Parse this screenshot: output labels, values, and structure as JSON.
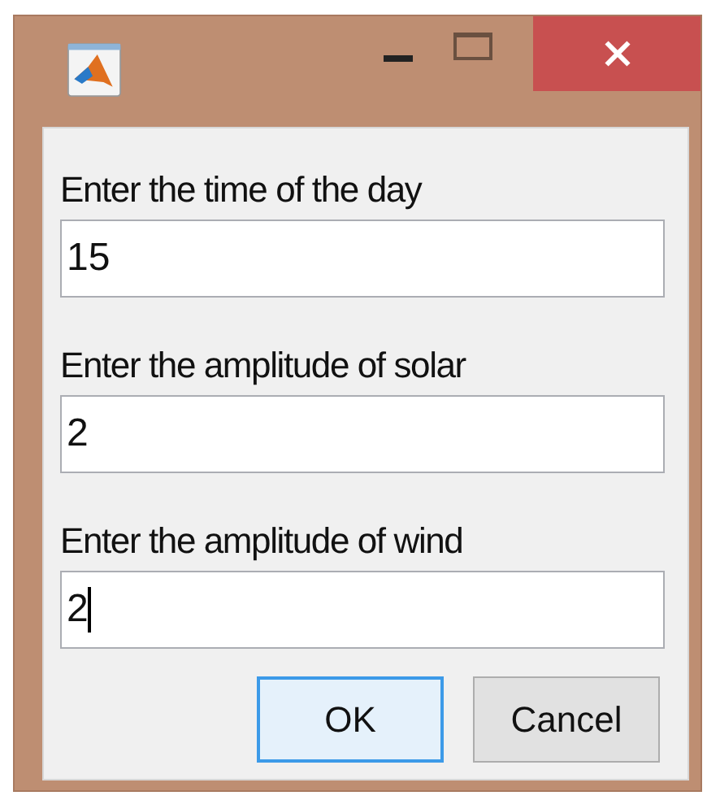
{
  "fields": [
    {
      "label": "Enter the time of the day",
      "value": "15",
      "focused": false
    },
    {
      "label": "Enter the amplitude of solar",
      "value": "2",
      "focused": false
    },
    {
      "label": "Enter the amplitude of wind",
      "value": "2",
      "focused": true
    }
  ],
  "buttons": [
    {
      "label": "OK",
      "default": true
    },
    {
      "label": "Cancel",
      "default": false
    }
  ]
}
